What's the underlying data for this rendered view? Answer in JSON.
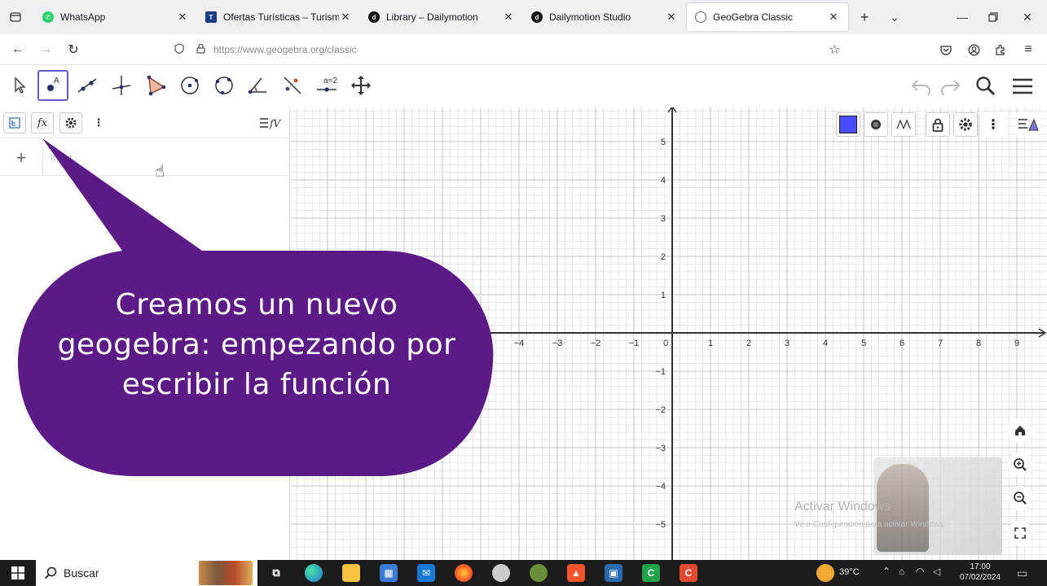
{
  "browser": {
    "tabs": [
      {
        "label": "WhatsApp",
        "color": "#25D366",
        "glyph": "✆"
      },
      {
        "label": "Ofertas Turísticas – Turismo –",
        "color": "#1a3c8b",
        "glyph": "T"
      },
      {
        "label": "Library – Dailymotion",
        "color": "#111111",
        "glyph": "d"
      },
      {
        "label": "Dailymotion Studio",
        "color": "#111111",
        "glyph": "d"
      },
      {
        "label": "GeoGebra Classic",
        "color": "#666666",
        "glyph": "○"
      }
    ],
    "active_tab": 4,
    "url": "https://www.geogebra.org/classic"
  },
  "algebra": {
    "input_placeholder": "Input..."
  },
  "graphics": {
    "x_ticks": [
      "−4",
      "−3",
      "−2",
      "−1",
      "0",
      "1",
      "2",
      "3",
      "4",
      "5",
      "6",
      "7",
      "8",
      "9"
    ],
    "y_ticks_pos": [
      "1",
      "2",
      "3",
      "4",
      "5"
    ],
    "y_ticks_neg": [
      "−1",
      "−2",
      "−3",
      "−4",
      "−5"
    ],
    "activate_title": "Activar Windows",
    "activate_sub": "Ve a Configuración para activar Windows."
  },
  "overlay": {
    "text": "Creamos un nuevo geogebra: empezando por escribir la función",
    "color": "#5b1a86"
  },
  "taskbar": {
    "search_label": "Buscar",
    "temperature": "39°C",
    "time": "17:00",
    "date": "07/02/2024"
  }
}
